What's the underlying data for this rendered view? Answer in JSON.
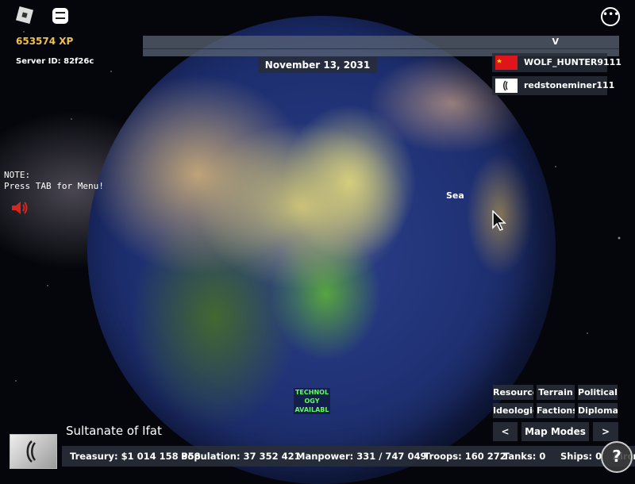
{
  "hud": {
    "xp": "653574 XP",
    "server_id": "Server ID: 82f26c",
    "top_bar_label": "V",
    "date": "November 13, 2031",
    "note_line1": "NOTE:",
    "note_line2": "Press TAB for Menu!",
    "sea_label": "Sea",
    "tech_notice": "TECHNOL OGY AVAILABL"
  },
  "players": [
    {
      "name": "WOLF_HUNTER9111",
      "flag_color": "#e0141b"
    },
    {
      "name": "redstoneminer111",
      "flag_color": "#ffffff"
    }
  ],
  "map_modes": {
    "buttons": [
      "Resource",
      "Terrain",
      "Political",
      "Ideologie",
      "Factions",
      "Diplomat"
    ],
    "prev": "<",
    "label": "Map Modes",
    "next": ">"
  },
  "nation": {
    "name": "Sultanate of Ifat"
  },
  "stats": {
    "treasury": "Treasury:  $1 014 158 358",
    "population": "Population: 37 352 421",
    "manpower": "Manpower:  331  /  747 049",
    "troops": "Troops: 160 272",
    "tanks": "Tanks: 0",
    "ships": "Ships: 0",
    "aircraft": "Aircr"
  },
  "colors": {
    "xp_gold": "#f0c04a",
    "tech_green": "#5dff5d",
    "panel": "#282d37"
  },
  "icons": [
    "roblox-menu-icon",
    "chat-icon",
    "more-options-icon",
    "speaker-icon",
    "help-icon",
    "mouse-cursor-icon"
  ]
}
